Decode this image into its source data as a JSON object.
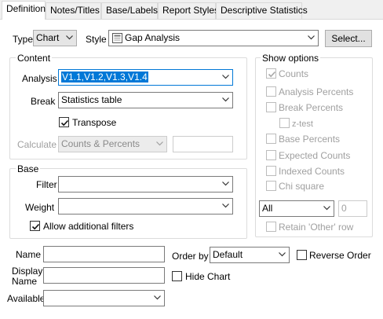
{
  "tabs": [
    "Definition",
    "Notes/Titles",
    "Base/Labels",
    "Report Styles",
    "Descriptive Statistics"
  ],
  "top": {
    "type_label": "Type",
    "type_value": "Chart",
    "style_label": "Style",
    "style_value": "Gap Analysis",
    "select_button": "Select..."
  },
  "content": {
    "title": "Content",
    "analysis_label": "Analysis",
    "analysis_value": "V1.1,V1.2,V1.3,V1.4",
    "break_label": "Break",
    "break_value": "Statistics table",
    "transpose_label": "Transpose",
    "transpose_checked": true,
    "calculate_label": "Calculate",
    "calculate_value": "Counts & Percents"
  },
  "base": {
    "title": "Base",
    "filter_label": "Filter",
    "weight_label": "Weight",
    "allow_label": "Allow additional filters",
    "allow_checked": true
  },
  "show_options": {
    "title": "Show options",
    "items": [
      {
        "label": "Counts",
        "checked": true
      },
      {
        "label": "Analysis Percents",
        "checked": false
      },
      {
        "label": "Break Percents",
        "checked": false
      },
      {
        "label": "z-test",
        "checked": false
      },
      {
        "label": "Base Percents",
        "checked": false
      },
      {
        "label": "Expected Counts",
        "checked": false
      },
      {
        "label": "Indexed Counts",
        "checked": false
      },
      {
        "label": "Chi square",
        "checked": false
      }
    ],
    "all_value": "All",
    "number_value": "0",
    "retain_label": "Retain 'Other' row"
  },
  "bottom": {
    "name_label": "Name",
    "display_name_label_1": "Display",
    "display_name_label_2": "Name",
    "available_label": "Available",
    "order_by_label": "Order by",
    "order_by_value": "Default",
    "reverse_order_label": "Reverse Order",
    "hide_chart_label": "Hide Chart"
  }
}
